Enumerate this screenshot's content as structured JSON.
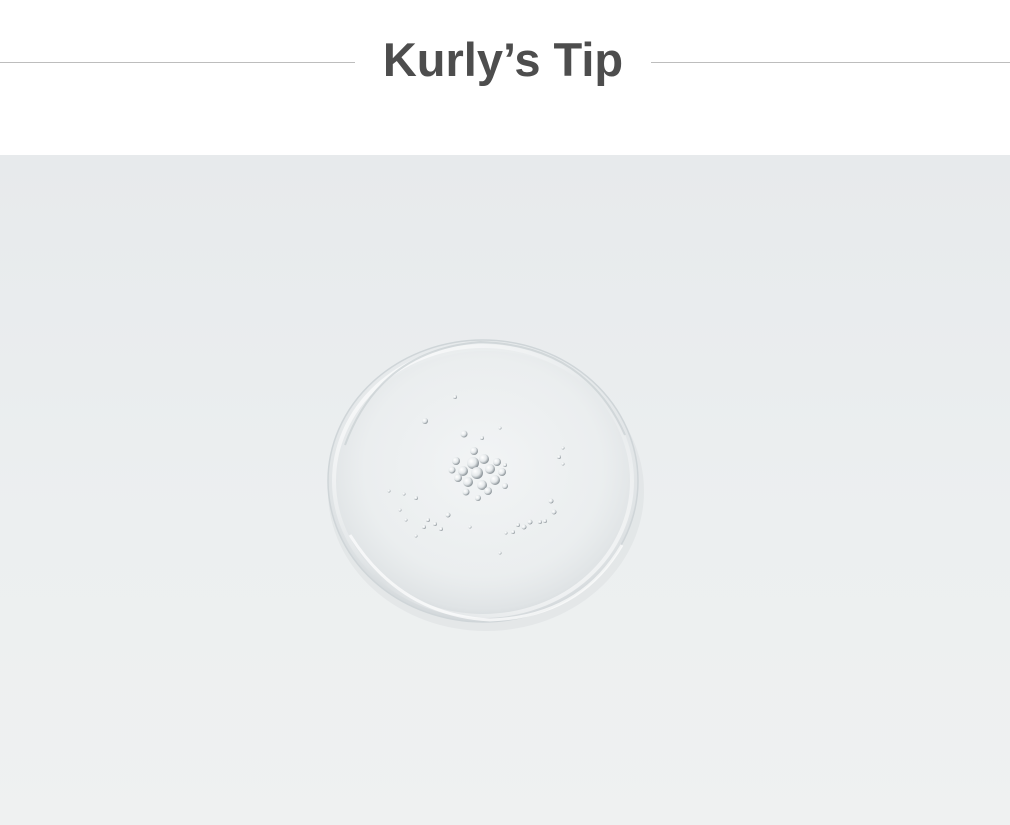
{
  "tip_section": {
    "title": "Kurly’s Tip"
  },
  "photo": {
    "subject": "droplet-icon",
    "background_color": "#eaeded"
  },
  "colors": {
    "title_text": "#4d4d4d",
    "divider": "#bdbdbd",
    "page_background": "#ffffff"
  }
}
